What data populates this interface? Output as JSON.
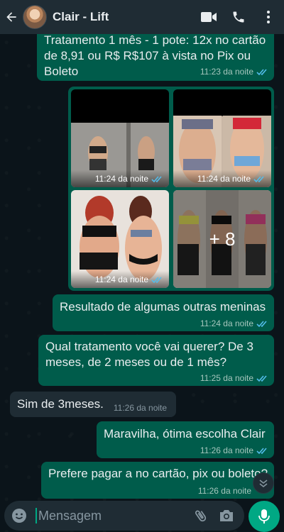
{
  "header": {
    "contact_name": "Clair - Lift"
  },
  "messages": [
    {
      "text": "Tratamento 1 mês - 1 pote: 12x no cartão de 8,91 ou  R$ R$107 à vista no Pix ou Boleto",
      "time": "11:23 da noite"
    },
    {
      "text": "Resultado de algumas outras meninas",
      "time": "11:24 da noite"
    },
    {
      "text": "Qual tratamento você vai querer? De 3 meses, de 2 meses ou de 1 mês?",
      "time": "11:25 da noite"
    },
    {
      "text": "Sim de 3meses.",
      "time": "11:26 da noite"
    },
    {
      "text": "Maravilha, ótima escolha Clair",
      "time": "11:26 da noite"
    },
    {
      "text": "Prefere pagar a no cartão, pix ou boleto?",
      "time": "11:26 da noite"
    }
  ],
  "media": {
    "times": [
      "11:24 da noite",
      "11:24 da noite",
      "11:24 da noite"
    ],
    "more_count": "+ 8"
  },
  "composer": {
    "placeholder": "Mensagem"
  },
  "colors": {
    "outgoing": "#005c4b",
    "incoming": "#1f2c34",
    "accent": "#00a884",
    "read_tick": "#53bdeb"
  },
  "icons": [
    "back-arrow-icon",
    "video-call-icon",
    "phone-icon",
    "more-vert-icon",
    "emoji-icon",
    "attach-icon",
    "camera-icon",
    "mic-icon",
    "chevron-down-icon"
  ]
}
